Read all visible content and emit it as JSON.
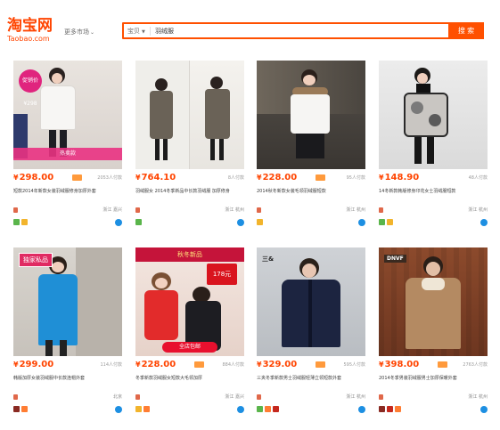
{
  "header": {
    "logo_cn": "淘宝网",
    "logo_en": "Taobao.com",
    "more_market": "更多市场",
    "search_type": "宝贝",
    "search_query": "羽绒服",
    "search_button": "搜 索"
  },
  "products": [
    {
      "price": "298.00",
      "sales": "2053人付款",
      "title": "短款2014年新款女装羽绒服修身加厚外套",
      "shop": "",
      "location": "浙江 嘉兴",
      "promo_text": "促销价 ¥298",
      "promo_banner": "热卖款"
    },
    {
      "price": "764.10",
      "sales": "8人付款",
      "title": "羽绒服女 2014冬季新品中长款羽绒服 加厚修身",
      "shop": "",
      "location": "浙江 杭州",
      "promo_text": "",
      "promo_banner": ""
    },
    {
      "price": "228.00",
      "sales": "95人付款",
      "title": "2014秋冬新款女装毛领羽绒服短款",
      "shop": "",
      "location": "浙江 杭州",
      "promo_text": "",
      "promo_banner": ""
    },
    {
      "price": "148.90",
      "sales": "48人付款",
      "title": "14冬新款韩版修身印花女士羽绒服短款",
      "shop": "",
      "location": "浙江 杭州",
      "promo_text": "",
      "promo_banner": ""
    },
    {
      "price": "299.00",
      "sales": "114人付款",
      "title": "韩版加厚女装羽绒服中长款连帽外套",
      "shop": "",
      "location": "北京",
      "promo_text": "独家私品",
      "promo_banner": ""
    },
    {
      "price": "228.00",
      "sales": "884人付款",
      "title": "冬季新款羽绒服女短款大毛领加厚",
      "shop": "",
      "location": "浙江 嘉兴",
      "promo_text": "秋冬新品",
      "promo_banner": "全店包邮",
      "promo_price": "178元"
    },
    {
      "price": "329.00",
      "sales": "595人付款",
      "title": "三夹冬季新款男士羽绒服轻薄立领短款外套",
      "shop": "",
      "location": "浙江 杭州",
      "promo_text": "三&",
      "promo_banner": ""
    },
    {
      "price": "398.00",
      "sales": "2763人付款",
      "title": "2014冬季男装羽绒服男士加厚保暖外套",
      "shop": "",
      "location": "浙江 杭州",
      "promo_text": "DNVF",
      "promo_banner": ""
    }
  ],
  "colors": {
    "brand_orange": "#ff4400",
    "search_border": "#ff5000",
    "wangwang_blue": "#1d8fe2"
  },
  "icons": {
    "price_tag": "promo-tag-icon",
    "shop": "shop-icon",
    "wangwang": "wangwang-chat-icon"
  }
}
